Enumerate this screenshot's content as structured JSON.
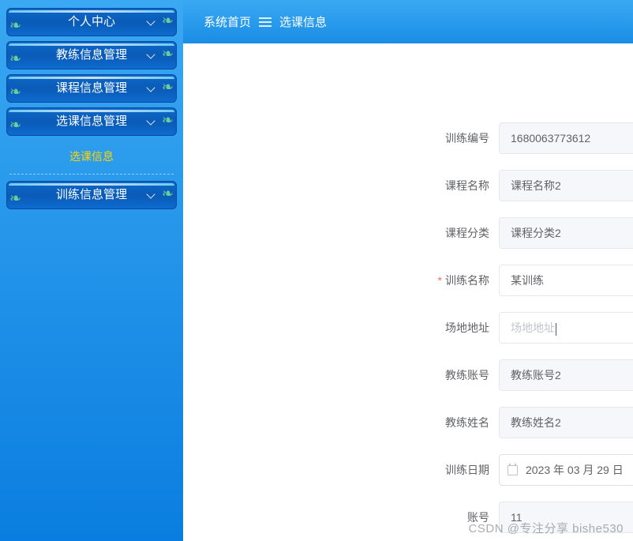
{
  "sidebar": {
    "items": [
      {
        "label": "个人中心"
      },
      {
        "label": "教练信息管理"
      },
      {
        "label": "课程信息管理"
      },
      {
        "label": "选课信息管理"
      },
      {
        "label": "训练信息管理"
      }
    ],
    "submenu": {
      "label": "选课信息"
    }
  },
  "breadcrumb": {
    "home": "系统首页",
    "current": "选课信息"
  },
  "form": {
    "rows": [
      {
        "label": "训练编号",
        "value": "1680063773612",
        "required": false,
        "type": "readonly"
      },
      {
        "label": "课程名称",
        "value": "课程名称2",
        "required": false,
        "type": "readonly"
      },
      {
        "label": "课程分类",
        "value": "课程分类2",
        "required": false,
        "type": "readonly"
      },
      {
        "label": "训练名称",
        "value": "某训练",
        "required": true,
        "type": "text"
      },
      {
        "label": "场地地址",
        "value": "",
        "placeholder": "场地地址",
        "required": false,
        "type": "text-focused"
      },
      {
        "label": "教练账号",
        "value": "教练账号2",
        "required": false,
        "type": "readonly"
      },
      {
        "label": "教练姓名",
        "value": "教练姓名2",
        "required": false,
        "type": "readonly"
      },
      {
        "label": "训练日期",
        "value": "2023 年 03 月 29 日",
        "required": false,
        "type": "date"
      },
      {
        "label": "账号",
        "value": "11",
        "required": false,
        "type": "readonly"
      }
    ]
  },
  "watermark": "CSDN @专注分享 bishe530"
}
